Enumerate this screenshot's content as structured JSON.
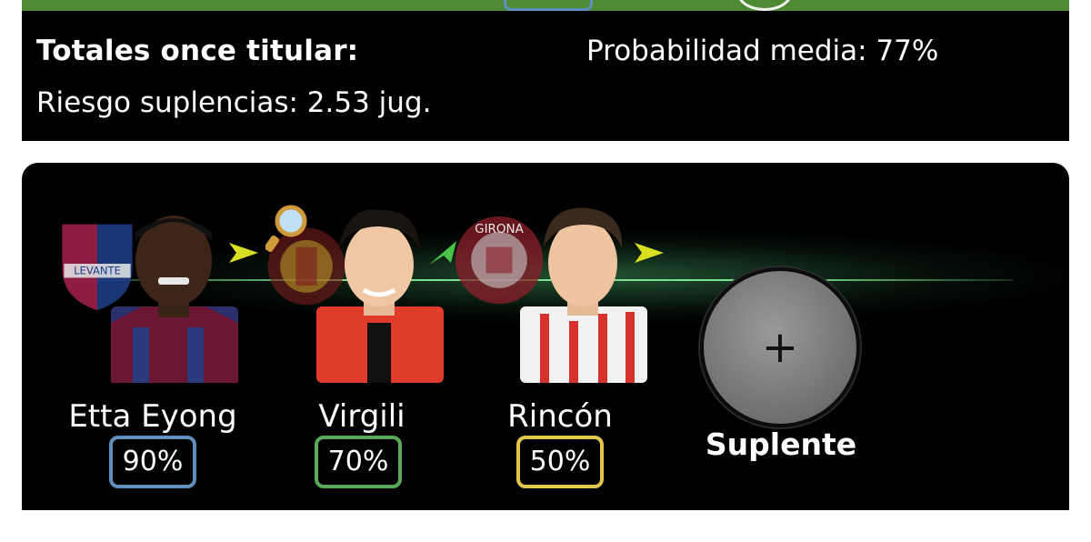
{
  "totals": {
    "title": "Totales once titular:",
    "risk": "Riesgo suplencias: 2.53 jug.",
    "probability": "Probabilidad media: 77%"
  },
  "players": [
    {
      "name": "Etta Eyong",
      "probability": "90%",
      "border_color": "#5f8fbf",
      "arrow": "arrow-right-icon",
      "arrow_color": "#d9e021",
      "club_badge": "levante-badge"
    },
    {
      "name": "Virgili",
      "probability": "70%",
      "border_color": "#5aa85a",
      "arrow": "arrow-up-right-icon",
      "arrow_color": "#4cc44c",
      "club_badge": "mallorca-badge",
      "extra_icon": "magnifier-icon"
    },
    {
      "name": "Rincón",
      "probability": "50%",
      "border_color": "#e4c64a",
      "arrow": "arrow-right-icon",
      "arrow_color": "#d9e021",
      "club_badge": "girona-badge"
    }
  ],
  "substitute": {
    "label": "Suplente",
    "icon": "plus-icon",
    "plus": "+"
  },
  "colors": {
    "pitch": "#4d8a33",
    "panel": "#000000",
    "glow": "#7de08f"
  }
}
